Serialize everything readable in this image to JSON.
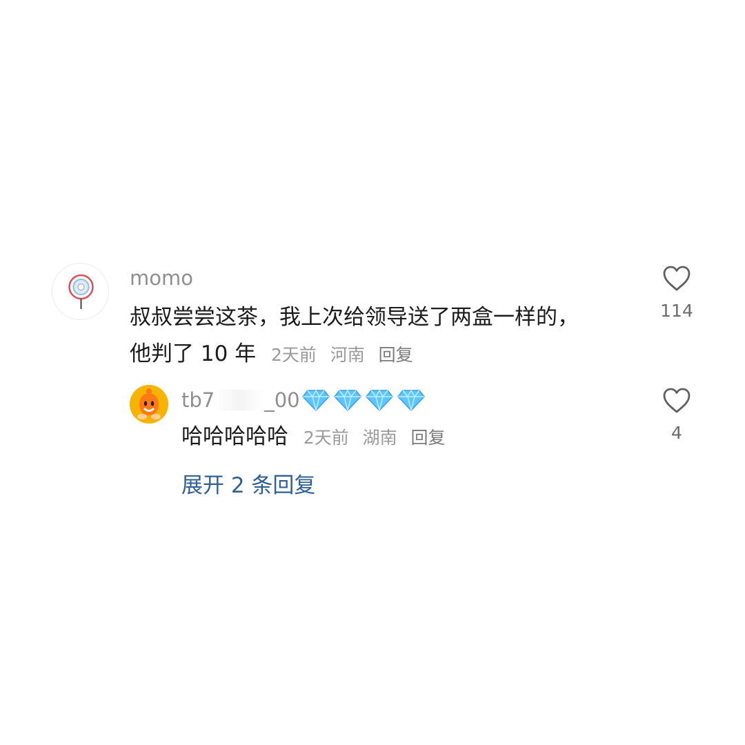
{
  "main_comment": {
    "username": "momo",
    "text_line1": "叔叔尝尝这茶，我上次给领导送了两盒一样的，",
    "text_line2": "他判了 10 年",
    "time": "2天前",
    "location": "河南",
    "reply_label": "回复",
    "like_count": "114",
    "avatar_icon": "lollipop-avatar-icon"
  },
  "reply_comment": {
    "username_prefix": "tb7",
    "username_suffix": "_00",
    "text": "哈哈哈哈哈",
    "time": "2天前",
    "location": "湖南",
    "reply_label": "回复",
    "like_count": "4",
    "avatar_icon": "cartoon-creature-avatar-icon",
    "badge_icon": "diamond-icon",
    "badge_count": 4
  },
  "expand": {
    "label": "展开 2 条回复"
  },
  "colors": {
    "link_blue": "#2e5f98",
    "meta_gray": "#9a9a9a",
    "diamond_blue": "#63c8ff"
  }
}
